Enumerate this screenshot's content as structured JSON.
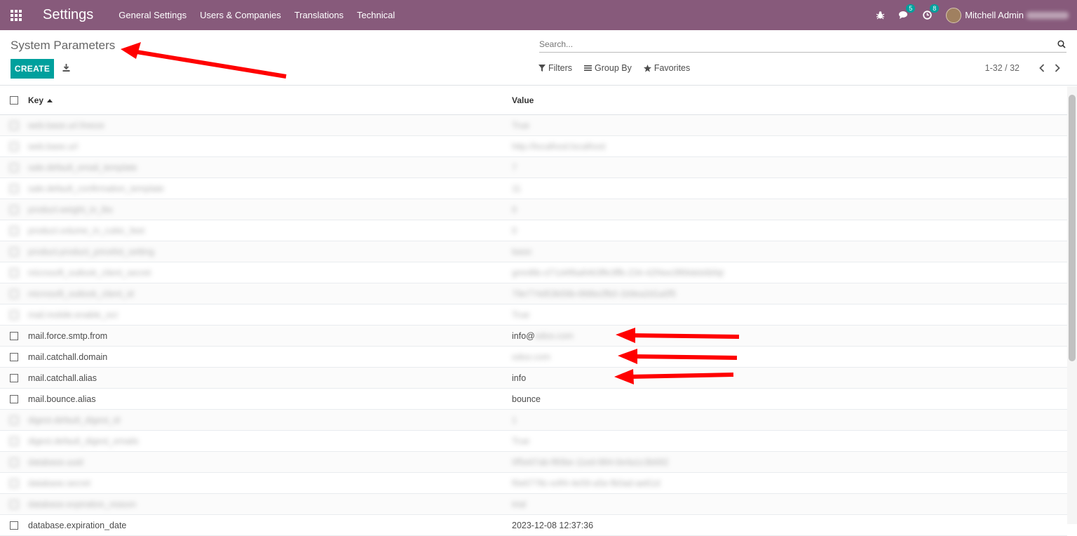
{
  "navbar": {
    "app_title": "Settings",
    "menu": [
      "General Settings",
      "Users & Companies",
      "Translations",
      "Technical"
    ],
    "messages_count": "5",
    "activities_count": "8",
    "user_name": "Mitchell Admin"
  },
  "control": {
    "title": "System Parameters",
    "create_label": "CREATE",
    "search_placeholder": "Search...",
    "filters_label": "Filters",
    "groupby_label": "Group By",
    "favorites_label": "Favorites",
    "pager": "1-32 / 32"
  },
  "table": {
    "headers": {
      "key": "Key",
      "value": "Value"
    },
    "rows": [
      {
        "key": "web.base.url.freeze",
        "value": "True",
        "blurred": true
      },
      {
        "key": "web.base.url",
        "value": "http://localhost:localhost",
        "blurred": true
      },
      {
        "key": "sale.default_email_template",
        "value": "7",
        "blurred": true
      },
      {
        "key": "sale.default_confirmation_template",
        "value": "11",
        "blurred": true
      },
      {
        "key": "product.weight_in_lbs",
        "value": "0",
        "blurred": true
      },
      {
        "key": "product.volume_in_cubic_feet",
        "value": "0",
        "blurred": true
      },
      {
        "key": "product.product_pricelist_setting",
        "value": "basic",
        "blurred": true
      },
      {
        "key": "microsoft_outlook_client_secret",
        "value": "gmn8ib-cl71d4f6a8463ffe3ffb-234-42f4ee3f89deb6bfqt",
        "blurred": true
      },
      {
        "key": "microsoft_outlook_client_id",
        "value": "79e774d53b56b-6fd6e2fb0-1b9ea2d1a0f5",
        "blurred": true
      },
      {
        "key": "mail.mobile.enable_ocr",
        "value": "True",
        "blurred": true
      },
      {
        "key": "mail.force.smtp.from",
        "value": "info@",
        "value_hidden": "odoo.com",
        "blurred": false
      },
      {
        "key": "mail.catchall.domain",
        "value": "",
        "value_hidden": "odoo.com",
        "blurred": false
      },
      {
        "key": "mail.catchall.alias",
        "value": "info",
        "blurred": false
      },
      {
        "key": "mail.bounce.alias",
        "value": "bounce",
        "blurred": false
      },
      {
        "key": "digest.default_digest_id",
        "value": "1",
        "blurred": true
      },
      {
        "key": "digest.default_digest_emails",
        "value": "True",
        "blurred": true
      },
      {
        "key": "database.uuid",
        "value": "0f5e67ab-f80be-11ed-984-0e4a1c3b692",
        "blurred": true
      },
      {
        "key": "database.secret",
        "value": "f0e6778c-e4f4-4e59-a5e-fb0ad-ae61d",
        "blurred": true
      },
      {
        "key": "database.expiration_reason",
        "value": "trial",
        "blurred": true
      },
      {
        "key": "database.expiration_date",
        "value": "2023-12-08 12:37:36",
        "blurred": false
      }
    ]
  },
  "colors": {
    "brand": "#875a7b",
    "accent": "#00a09d",
    "annotation": "#ff0000"
  }
}
